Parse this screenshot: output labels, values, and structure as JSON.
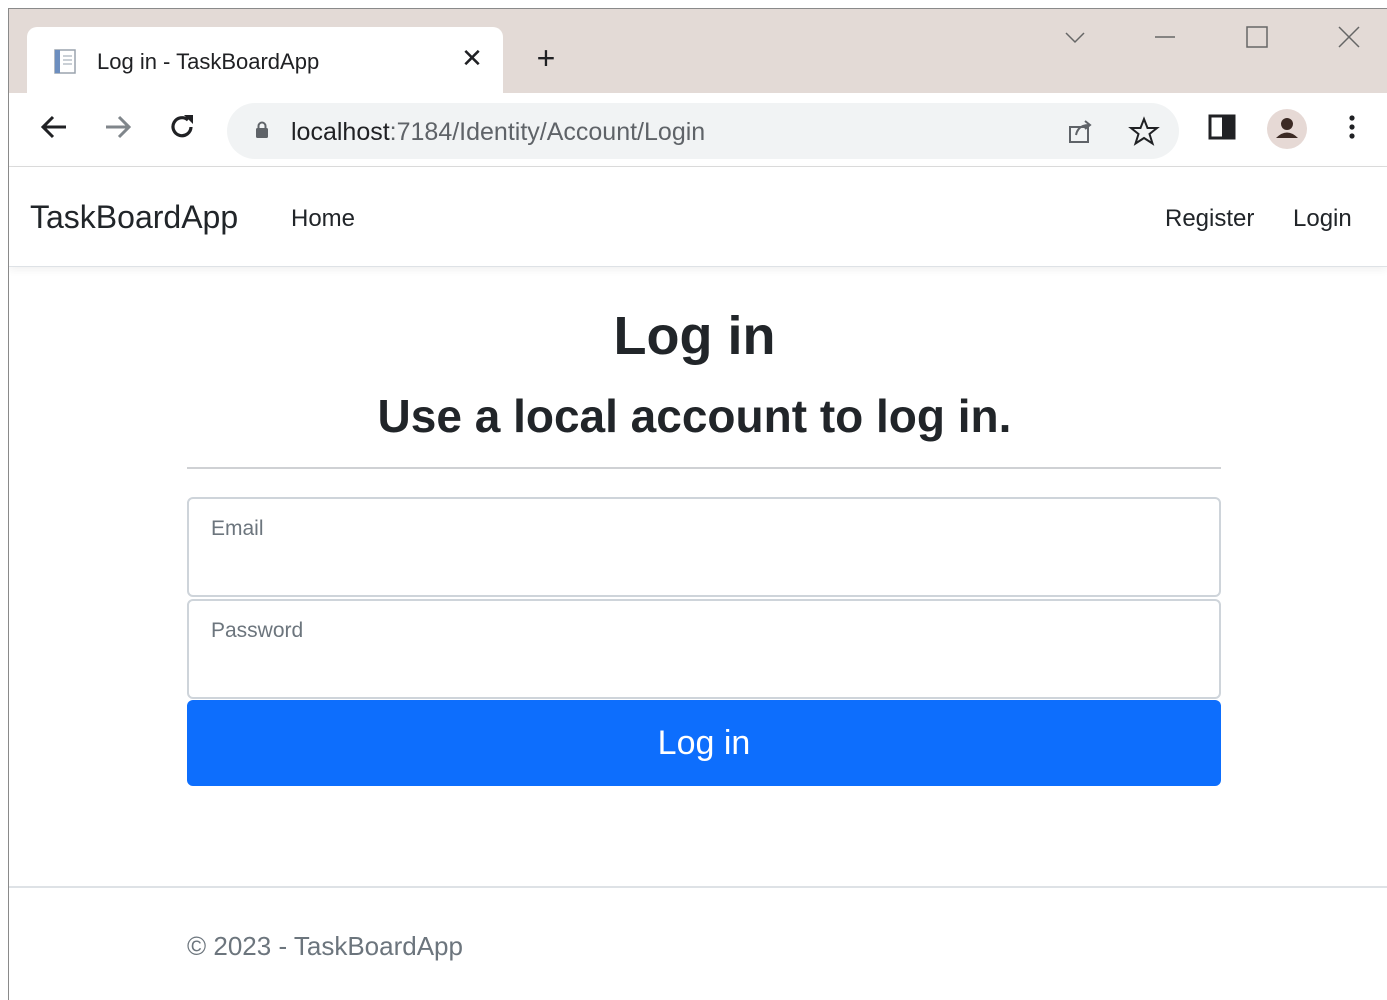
{
  "browser": {
    "tab_title": "Log in - TaskBoardApp",
    "tab_close": "✕",
    "new_tab": "+",
    "url_host": "localhost",
    "url_rest": ":7184/Identity/Account/Login",
    "icons": {
      "favicon": "page-icon",
      "back": "back-arrow-icon",
      "forward": "forward-arrow-icon",
      "reload": "reload-icon",
      "lock": "lock-icon",
      "share": "share-icon",
      "bookmark": "star-icon",
      "sidepanel": "side-panel-icon",
      "profile": "profile-avatar-icon",
      "menu": "kebab-menu-icon",
      "tab_search": "chevron-down-icon",
      "minimize": "minimize-icon",
      "maximize": "maximize-icon",
      "close": "close-icon"
    }
  },
  "navbar": {
    "brand": "TaskBoardApp",
    "home": "Home",
    "register": "Register",
    "login": "Login"
  },
  "main": {
    "title": "Log in",
    "subtitle": "Use a local account to log in.",
    "email_label": "Email",
    "password_label": "Password",
    "submit_label": "Log in"
  },
  "footer": {
    "text": "© 2023 - TaskBoardApp"
  },
  "colors": {
    "primary": "#0d6efd",
    "tabstrip": "#e3dad6",
    "omnibox": "#f1f3f4"
  }
}
